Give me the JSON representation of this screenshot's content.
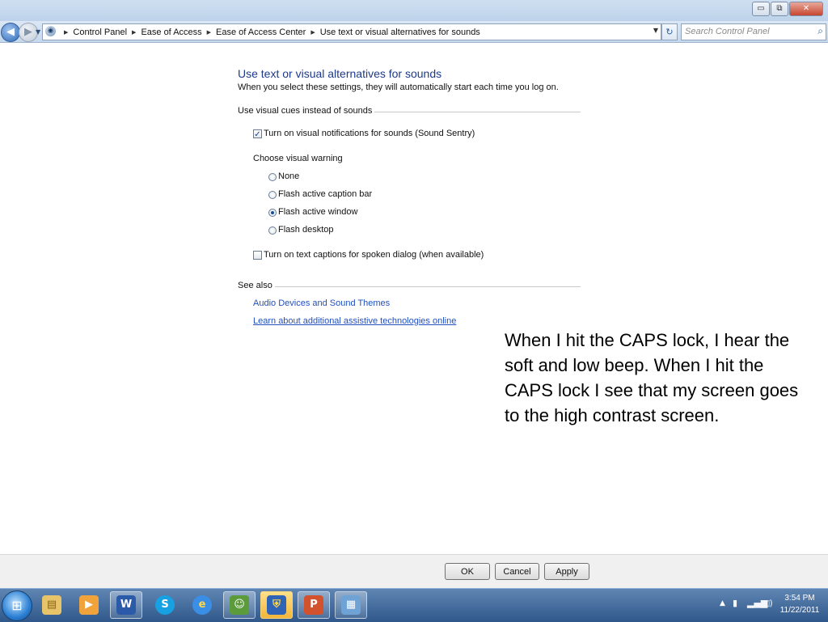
{
  "window": {
    "controls": {
      "minimize": "▭",
      "restore": "⧉",
      "close": "✕"
    }
  },
  "nav": {
    "back_icon": "◀",
    "forward_icon": "▶",
    "dropdown_icon": "▼",
    "breadcrumb": [
      "Control Panel",
      "Ease of Access",
      "Ease of Access Center",
      "Use text or visual alternatives for sounds"
    ],
    "refresh_icon": "↻",
    "search_placeholder": "Search Control Panel",
    "search_icon": "⌕"
  },
  "content": {
    "title": "Use text or visual alternatives for sounds",
    "description": "When you select these settings, they will automatically start each time you log on.",
    "section_visual_cues": "Use visual cues instead of sounds",
    "checkbox_sound_sentry": {
      "label": "Turn on visual notifications for sounds (Sound Sentry)",
      "checked": true
    },
    "choose_warning_label": "Choose visual warning",
    "warning_options": [
      {
        "label": "None",
        "selected": false
      },
      {
        "label": "Flash active caption bar",
        "selected": false
      },
      {
        "label": "Flash active window",
        "selected": true
      },
      {
        "label": "Flash desktop",
        "selected": false
      }
    ],
    "checkbox_text_captions": {
      "label": "Turn on text captions for spoken dialog (when available)",
      "checked": false
    },
    "section_see_also": "See also",
    "see_also_links": [
      "Audio Devices and Sound Themes",
      "Learn about additional assistive technologies online"
    ]
  },
  "annotation": "When I hit the CAPS lock, I hear the soft and low beep.  When I hit the CAPS lock I see that my screen goes to the high contrast screen.",
  "buttons": {
    "ok": "OK",
    "cancel": "Cancel",
    "apply": "Apply"
  },
  "taskbar": {
    "start_icon": "⊞",
    "apps": [
      {
        "name": "windows-explorer",
        "glyph": "▤",
        "open": false
      },
      {
        "name": "media-player",
        "glyph": "▶",
        "open": false
      },
      {
        "name": "microsoft-word",
        "glyph": "W",
        "open": true
      },
      {
        "name": "skype",
        "glyph": "S",
        "open": false
      },
      {
        "name": "internet-explorer",
        "glyph": "e",
        "open": false
      },
      {
        "name": "windows-live-messenger",
        "glyph": "☺",
        "open": true
      },
      {
        "name": "security-center",
        "glyph": "⛨",
        "open": true,
        "active": true
      },
      {
        "name": "powerpoint",
        "glyph": "P",
        "open": true
      },
      {
        "name": "control-panel",
        "glyph": "▦",
        "open": true
      }
    ],
    "tray": {
      "chevron": "▲",
      "time": "3:54 PM",
      "date": "11/22/2011"
    }
  }
}
